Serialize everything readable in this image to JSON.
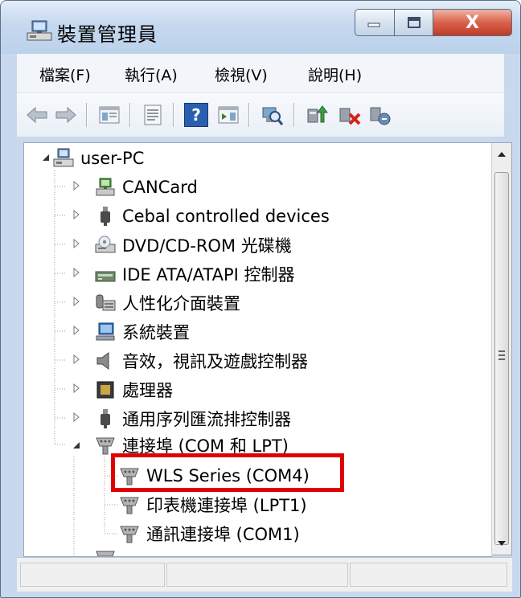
{
  "window": {
    "title": "裝置管理員",
    "close_glyph": "X"
  },
  "menu": {
    "items": [
      {
        "label": "檔案(F)"
      },
      {
        "label": "執行(A)"
      },
      {
        "label": "檢視(V)"
      },
      {
        "label": "說明(H)"
      }
    ]
  },
  "toolbar": {
    "icons": [
      "back-arrow-icon",
      "forward-arrow-icon",
      "console-tree-icon",
      "properties-icon",
      "help-icon",
      "action-pane-icon",
      "scan-hardware-icon",
      "update-driver-icon",
      "disable-device-icon",
      "uninstall-device-icon"
    ],
    "help_glyph": "?"
  },
  "tree": {
    "root": {
      "label": "user-PC",
      "icon": "computer-icon"
    },
    "categories": [
      {
        "label": "CANCard",
        "icon": "network-card-icon"
      },
      {
        "label": "Cebal controlled devices",
        "icon": "usb-plug-icon"
      },
      {
        "label": "DVD/CD-ROM 光碟機",
        "icon": "optical-drive-icon"
      },
      {
        "label": "IDE ATA/ATAPI 控制器",
        "icon": "ide-controller-icon"
      },
      {
        "label": "人性化介面裝置",
        "icon": "hid-device-icon"
      },
      {
        "label": "系統裝置",
        "icon": "system-device-icon"
      },
      {
        "label": "音效，視訊及遊戲控制器",
        "icon": "speaker-icon"
      },
      {
        "label": "處理器",
        "icon": "processor-icon"
      },
      {
        "label": "通用序列匯流排控制器",
        "icon": "usb-plug-icon"
      },
      {
        "label": "連接埠 (COM 和 LPT)",
        "icon": "port-connector-icon"
      }
    ],
    "ports": [
      {
        "label": "WLS Series (COM4)",
        "icon": "port-connector-icon"
      },
      {
        "label": "印表機連接埠 (LPT1)",
        "icon": "port-connector-icon"
      },
      {
        "label": "通訊連接埠 (COM1)",
        "icon": "port-connector-icon"
      }
    ]
  },
  "colors": {
    "highlight": "#e00000",
    "title_bar": "#c5d8ef",
    "close_button": "#c13a25"
  }
}
